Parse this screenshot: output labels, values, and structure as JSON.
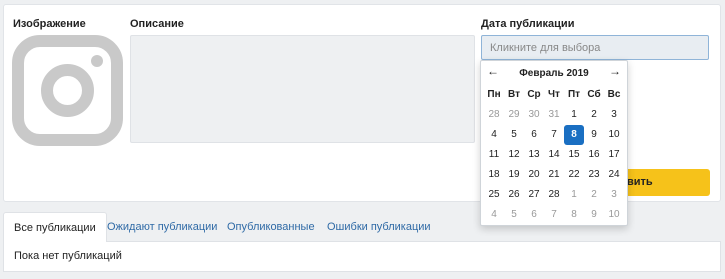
{
  "form": {
    "image_label": "Изображение",
    "description_label": "Описание",
    "date_label": "Дата публикации",
    "date_placeholder": "Кликните для выбора",
    "publish_button_partial": "вить"
  },
  "calendar": {
    "month": "Февраль 2019",
    "prev_icon": "arrow-left-icon",
    "next_icon": "arrow-right-icon",
    "weekdays": [
      "Пн",
      "Вт",
      "Ср",
      "Чт",
      "Пт",
      "Сб",
      "Вс"
    ],
    "weeks": [
      [
        "28",
        "29",
        "30",
        "31",
        "1",
        "2",
        "3"
      ],
      [
        "4",
        "5",
        "6",
        "7",
        "8",
        "9",
        "10"
      ],
      [
        "11",
        "12",
        "13",
        "14",
        "15",
        "16",
        "17"
      ],
      [
        "18",
        "19",
        "20",
        "21",
        "22",
        "23",
        "24"
      ],
      [
        "25",
        "26",
        "27",
        "28",
        "1",
        "2",
        "3"
      ],
      [
        "4",
        "5",
        "6",
        "7",
        "8",
        "9",
        "10"
      ]
    ],
    "selected_day": "8",
    "colors": {
      "selected": "#1a6fc2",
      "muted": "#999999"
    }
  },
  "tabs": [
    {
      "label": "Все публикации",
      "active": true
    },
    {
      "label": "Ожидают публикации",
      "active": false
    },
    {
      "label": "Опубликованные",
      "active": false
    },
    {
      "label": "Ошибки публикации",
      "active": false
    }
  ],
  "empty_message": "Пока нет публикаций",
  "colors": {
    "accent_button": "#f6c21a",
    "link": "#2f6aa6"
  }
}
